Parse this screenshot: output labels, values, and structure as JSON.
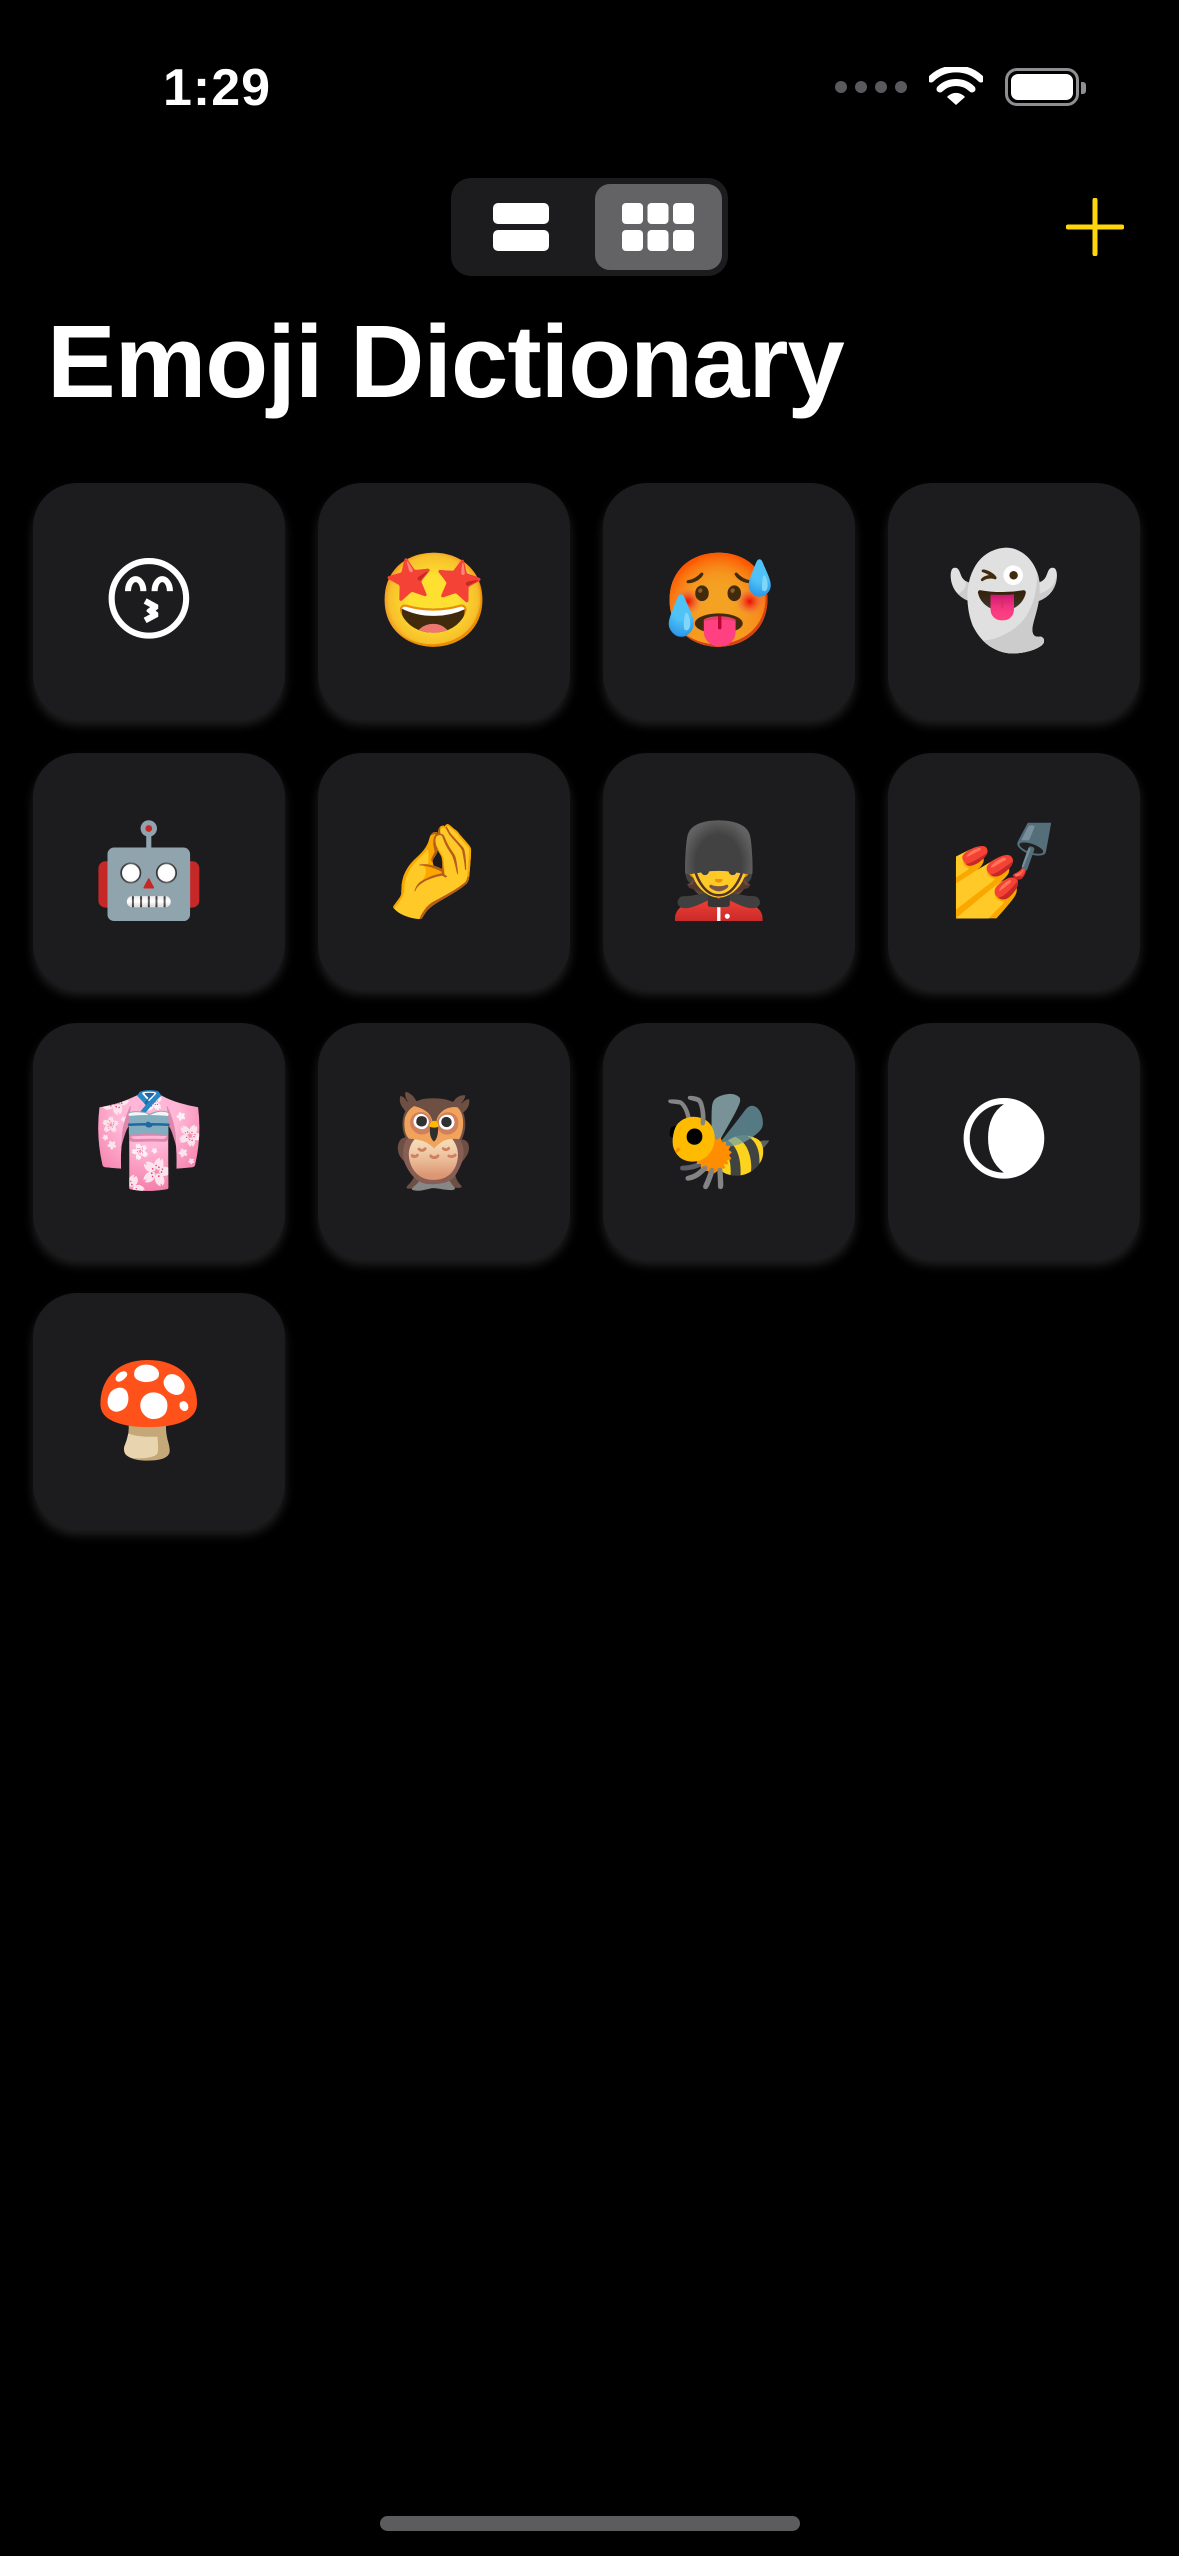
{
  "status_bar": {
    "time": "1:29"
  },
  "toolbar": {
    "layout_options": [
      {
        "icon": "list-layout-icon",
        "selected": false
      },
      {
        "icon": "grid-layout-icon",
        "selected": true
      }
    ],
    "add_icon": "plus-icon",
    "accent_color": "#FFD60A"
  },
  "header": {
    "title": "Emoji Dictionary"
  },
  "emojis": [
    "😙",
    "🤩",
    "🥵",
    "👻",
    "🤖",
    "🤌",
    "💂",
    "💅",
    "👘",
    "🦉",
    "🐝",
    "🌘",
    "🍄"
  ]
}
